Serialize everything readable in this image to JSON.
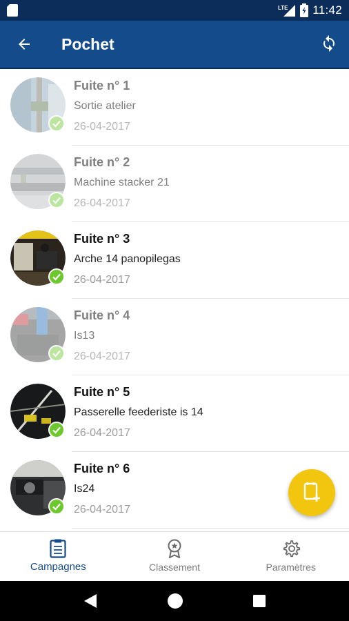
{
  "status_bar": {
    "network": "LTE",
    "time": "11:42"
  },
  "app_bar": {
    "title": "Pochet",
    "back_icon": "arrow-left-icon",
    "refresh_icon": "sync-icon"
  },
  "leaks": [
    {
      "title": "Fuite n° 1",
      "location": "Sortie atelier",
      "date": "26-04-2017",
      "faded": true
    },
    {
      "title": "Fuite n° 2",
      "location": "Machine stacker 21",
      "date": "26-04-2017",
      "faded": true
    },
    {
      "title": "Fuite n° 3",
      "location": "Arche 14 panopilegas",
      "date": "26-04-2017",
      "faded": false
    },
    {
      "title": "Fuite n° 4",
      "location": "Is13",
      "date": "26-04-2017",
      "faded": true
    },
    {
      "title": "Fuite n° 5",
      "location": "Passerelle feederiste is 14",
      "date": "26-04-2017",
      "faded": false
    },
    {
      "title": "Fuite n° 6",
      "location": "Is24",
      "date": "26-04-2017",
      "faded": false
    }
  ],
  "bottom_nav": {
    "items": [
      {
        "label": "Campagnes",
        "icon": "clipboard-icon",
        "active": true
      },
      {
        "label": "Classement",
        "icon": "award-icon",
        "active": false
      },
      {
        "label": "Paramètres",
        "icon": "gear-icon",
        "active": false
      }
    ]
  },
  "colors": {
    "status_bar": "#0c2d5a",
    "app_bar": "#134b8b",
    "check": "#6cc82c",
    "fab": "#f2c60f",
    "active_nav": "#134b8b"
  }
}
